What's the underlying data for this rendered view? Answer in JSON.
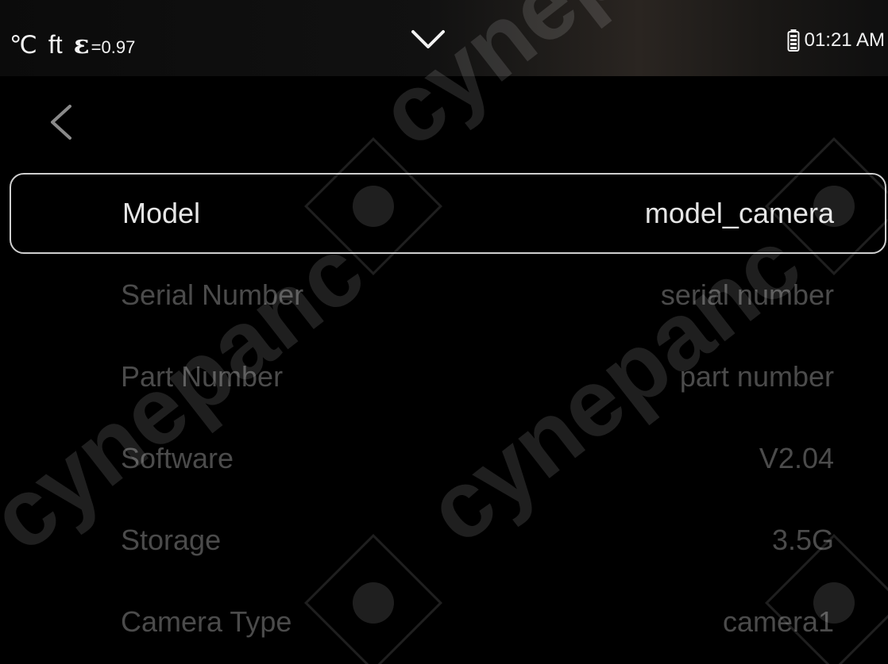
{
  "status_bar": {
    "temp_unit": "℃",
    "distance_unit": "ft",
    "emissivity_symbol": "ε",
    "emissivity_value": "=0.97",
    "battery_icon": "battery-icon",
    "time": "01:21 AM",
    "dropdown_icon": "chevron-down-icon"
  },
  "nav": {
    "back_icon": "chevron-left-icon"
  },
  "device_info": {
    "rows": [
      {
        "label": "Model",
        "value": "model_camera",
        "selected": true
      },
      {
        "label": "Serial Number",
        "value": "serial number",
        "selected": false
      },
      {
        "label": "Part Number",
        "value": "part number",
        "selected": false
      },
      {
        "label": "Software",
        "value": "V2.04",
        "selected": false
      },
      {
        "label": "Storage",
        "value": "3.5G",
        "selected": false
      },
      {
        "label": "Camera Type",
        "value": "camera1",
        "selected": false
      }
    ]
  },
  "watermark": {
    "text": "cynepanс"
  },
  "colors": {
    "background": "#000000",
    "active_text": "#e6e6e6",
    "inactive_text": "#4b4b4b",
    "selection_border": "#cfcfcf"
  }
}
